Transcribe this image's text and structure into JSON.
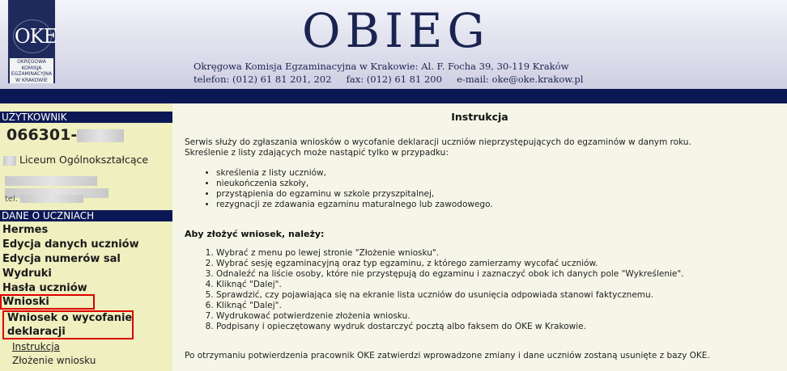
{
  "header": {
    "logo": {
      "mark": "OKE",
      "lines": [
        "OKRĘGOWA",
        "KOMISJA",
        "EGZAMINACYJNA",
        "W KRAKOWIE"
      ]
    },
    "title": "OBIEG",
    "address": "Okręgowa Komisja Egzaminacyjna w Krakowie: Al. F. Focha 39, 30-119 Kraków",
    "contact": "telefon: (012) 61 81 201, 202     fax: (012) 61 81 200     e-mail: oke@oke.krakow.pl"
  },
  "sidebar": {
    "user_header": "UŻYTKOWNIK",
    "user_id": "066301-",
    "school": "Liceum Ogólnokształcące",
    "tel_label": "tel.",
    "students_header": "DANE O UCZNIACH",
    "menu": [
      {
        "label": "Hermes"
      },
      {
        "label": "Edycja danych uczniów"
      },
      {
        "label": "Edycja numerów sal"
      },
      {
        "label": "Wydruki"
      },
      {
        "label": "Hasła uczniów"
      },
      {
        "label": "Wnioski"
      }
    ],
    "submenu_title_line1": "Wniosek o wycofanie",
    "submenu_title_line2": "deklaracji",
    "links": [
      {
        "label": "Instrukcja"
      },
      {
        "label": "Złożenie wniosku"
      }
    ],
    "colors": {
      "highlight_border": "#dd0000",
      "header_bg": "#0c1855",
      "sidebar_bg": "#efefc0"
    }
  },
  "main": {
    "title": "Instrukcja",
    "intro_line1": "Serwis służy do zgłaszania wniosków o wycofanie deklaracji uczniów nieprzystępujących do egzaminów w danym roku.",
    "intro_line2": "Skreślenie z listy zdających może nastąpić tylko w przypadku:",
    "cases": [
      "skreślenia z listy uczniów,",
      "nieukończenia szkoły,",
      "przystąpienia do egzaminu w szkole przyszpitalnej,",
      "rezygnacji ze zdawania egzaminu maturalnego lub zawodowego."
    ],
    "steps_header": "Aby złożyć wniosek, należy:",
    "steps": [
      "Wybrać z menu po lewej stronie \"Złożenie wniosku\".",
      "Wybrać sesję egzaminacyjną oraz typ egzaminu, z którego zamierzamy wycofać uczniów.",
      "Odnaleźć na liście osoby, które nie przystępują do egzaminu i zaznaczyć obok ich danych pole \"Wykreślenie\".",
      "Kliknąć \"Dalej\".",
      "Sprawdzić, czy pojawiająca się na ekranie lista uczniów do usunięcia odpowiada stanowi faktycznemu.",
      "Kliknąć \"Dalej\".",
      "Wydrukować potwierdzenie złożenia wniosku.",
      "Podpisany i opieczętowany wydruk dostarczyć pocztą albo faksem do OKE w Krakowie."
    ],
    "footer": "Po otrzymaniu potwierdzenia pracownik OKE zatwierdzi wprowadzone zmiany i dane uczniów zostaną usunięte z bazy OKE."
  }
}
